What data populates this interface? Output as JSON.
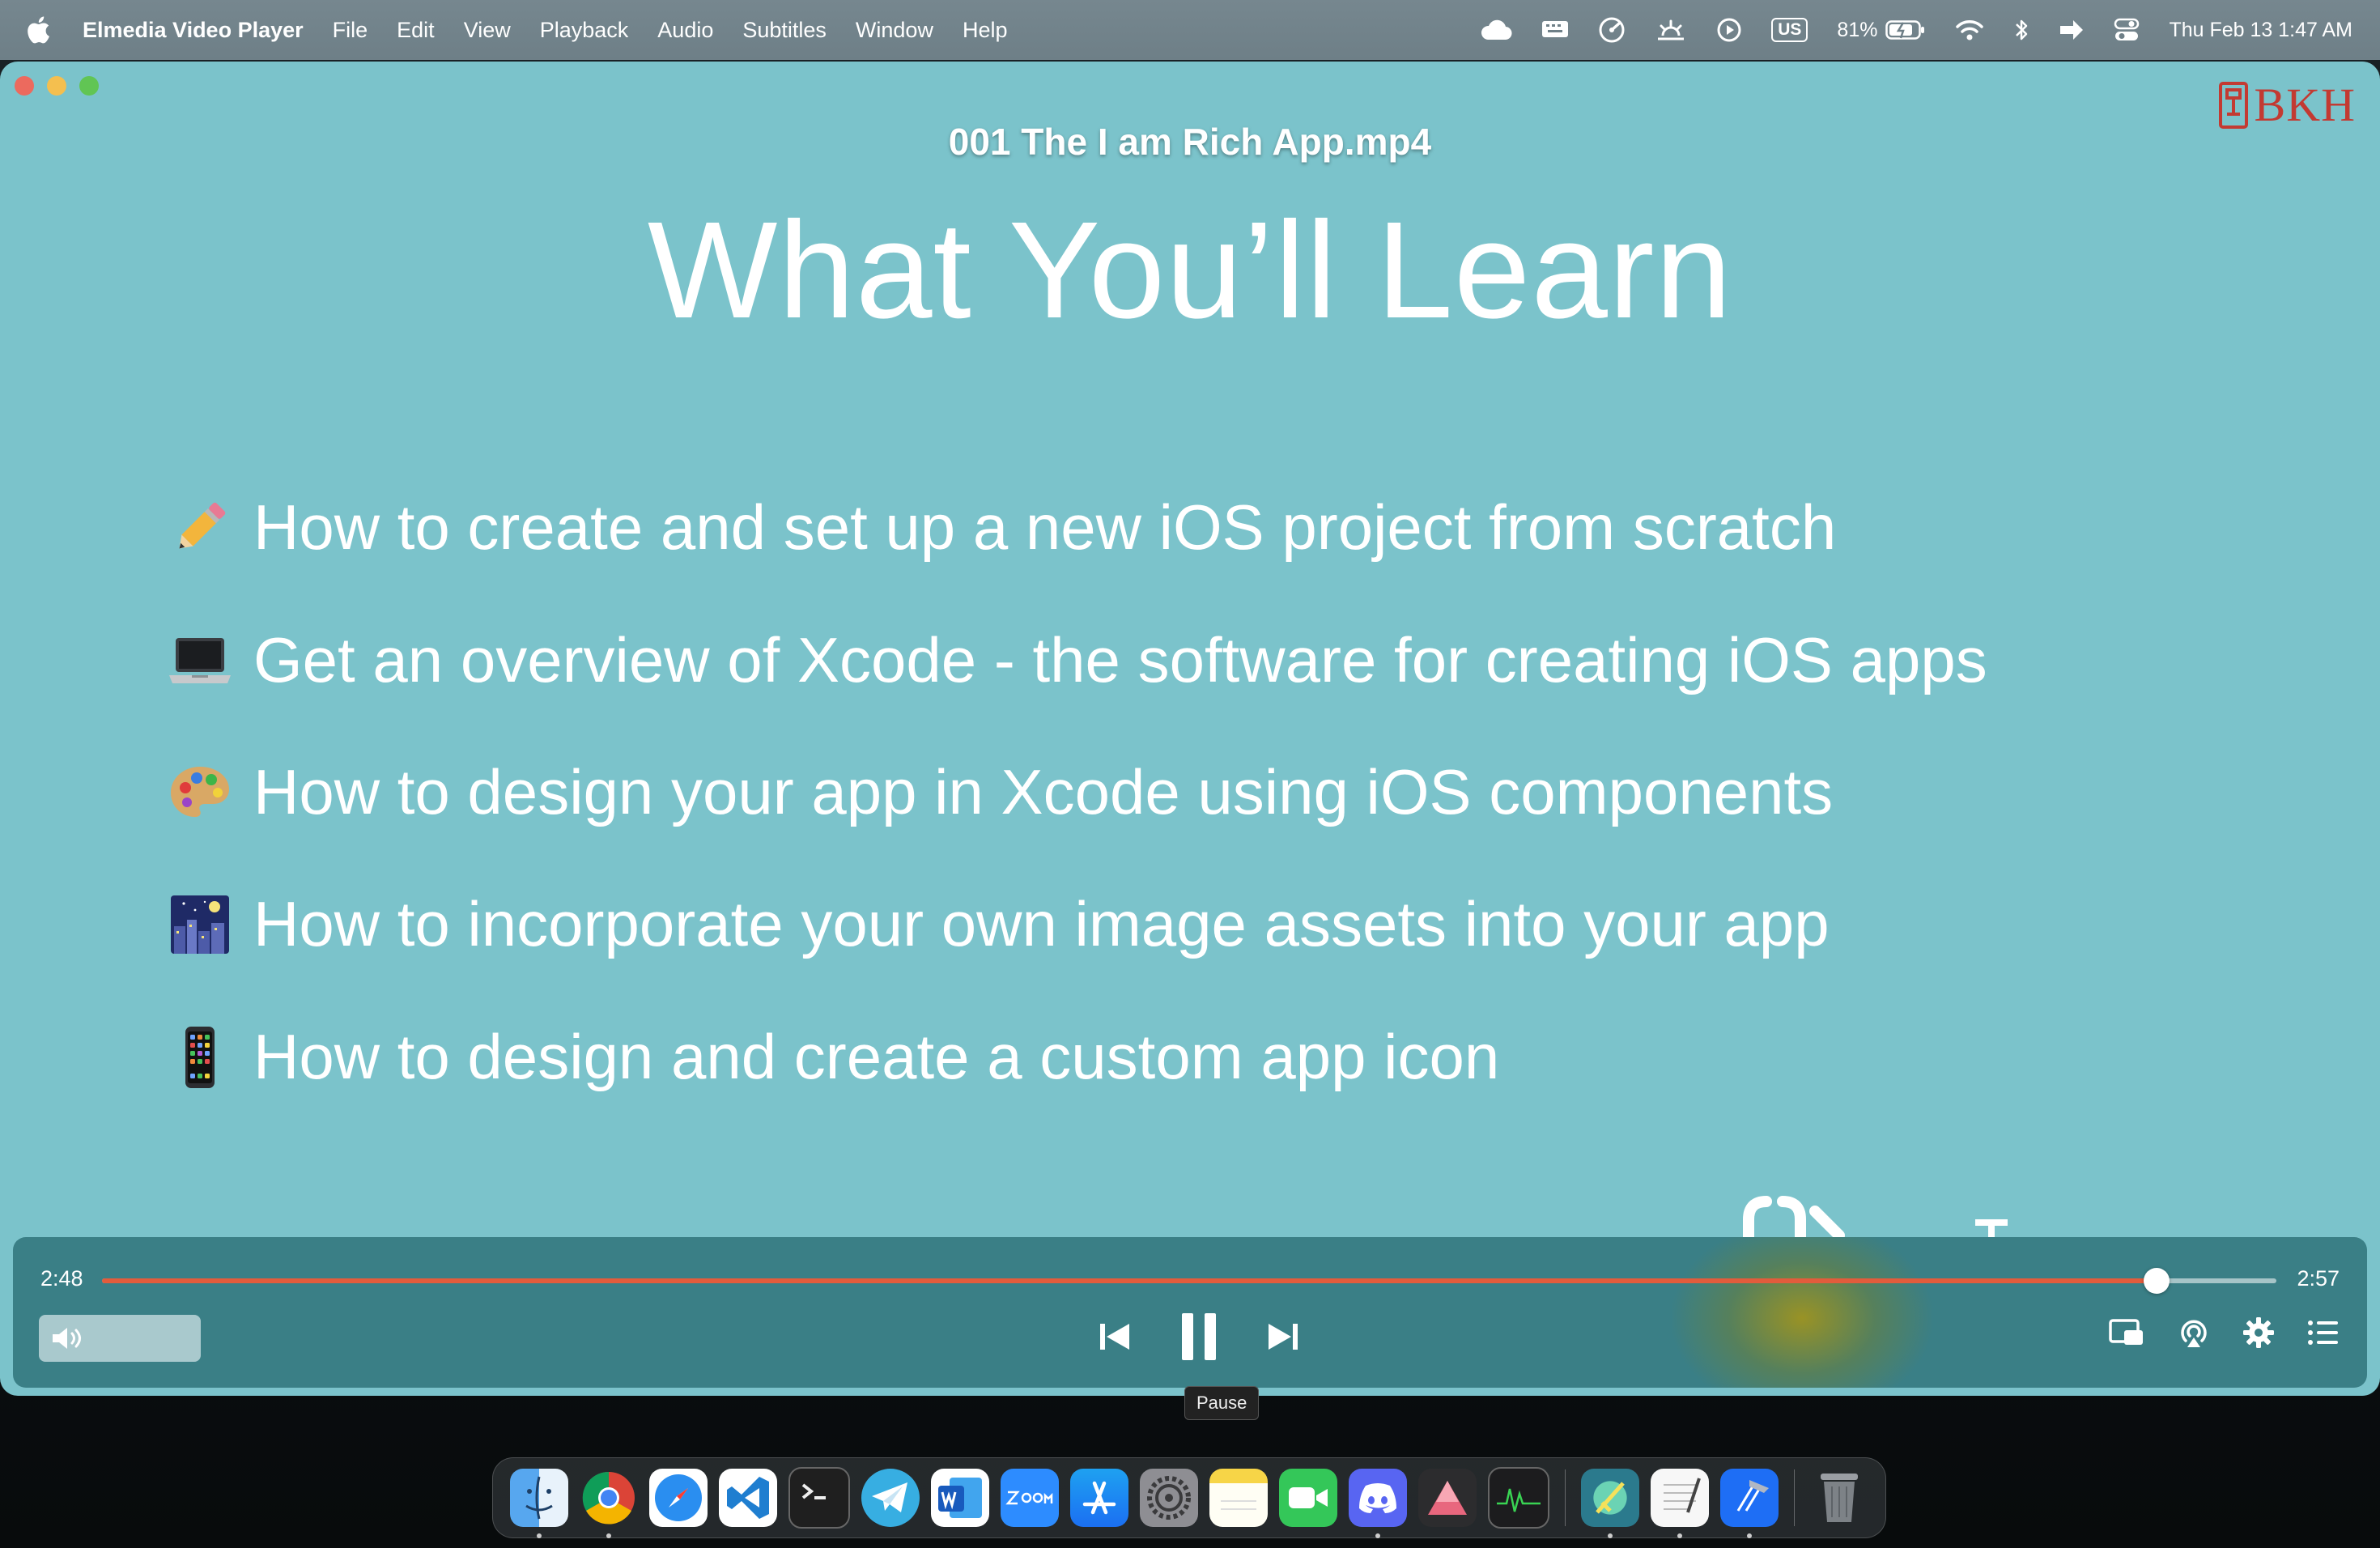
{
  "menubar": {
    "app_name": "Elmedia Video Player",
    "menus": [
      "File",
      "Edit",
      "View",
      "Playback",
      "Audio",
      "Subtitles",
      "Window",
      "Help"
    ],
    "status": {
      "keyboard": "US",
      "battery": "81%",
      "clock": "Thu Feb 13  1:47 AM"
    }
  },
  "window": {
    "video_title": "001 The I am Rich App.mp4",
    "logo_text": "BKH",
    "slide": {
      "heading": "What You’ll Learn",
      "bullets": [
        {
          "icon": "pencil-icon",
          "text": "How to create and set up a new iOS project from scratch"
        },
        {
          "icon": "laptop-icon",
          "text": "Get an overview of Xcode - the software for creating iOS apps"
        },
        {
          "icon": "palette-icon",
          "text": "How to design your app in Xcode using iOS components"
        },
        {
          "icon": "night-city-icon",
          "text": "How to incorporate your own image assets into your app"
        },
        {
          "icon": "phone-icon",
          "text": "How to design and create a custom app icon"
        }
      ]
    }
  },
  "player": {
    "current_time": "2:48",
    "total_time": "2:57",
    "progress_fraction": 0.945,
    "volume_fraction": 0.0,
    "tooltip": "Pause",
    "accent_color": "#e25c3c"
  },
  "dock": {
    "apps": [
      "Finder",
      "Chrome",
      "Safari",
      "Visual Studio Code",
      "Terminal",
      "Telegram",
      "Word",
      "Zoom",
      "App Store",
      "System Settings",
      "Notes",
      "FaceTime",
      "Discord",
      "Affinity",
      "Activity Monitor",
      "Elmedia Video Player",
      "TextEdit",
      "Xcode",
      "Trash"
    ]
  }
}
